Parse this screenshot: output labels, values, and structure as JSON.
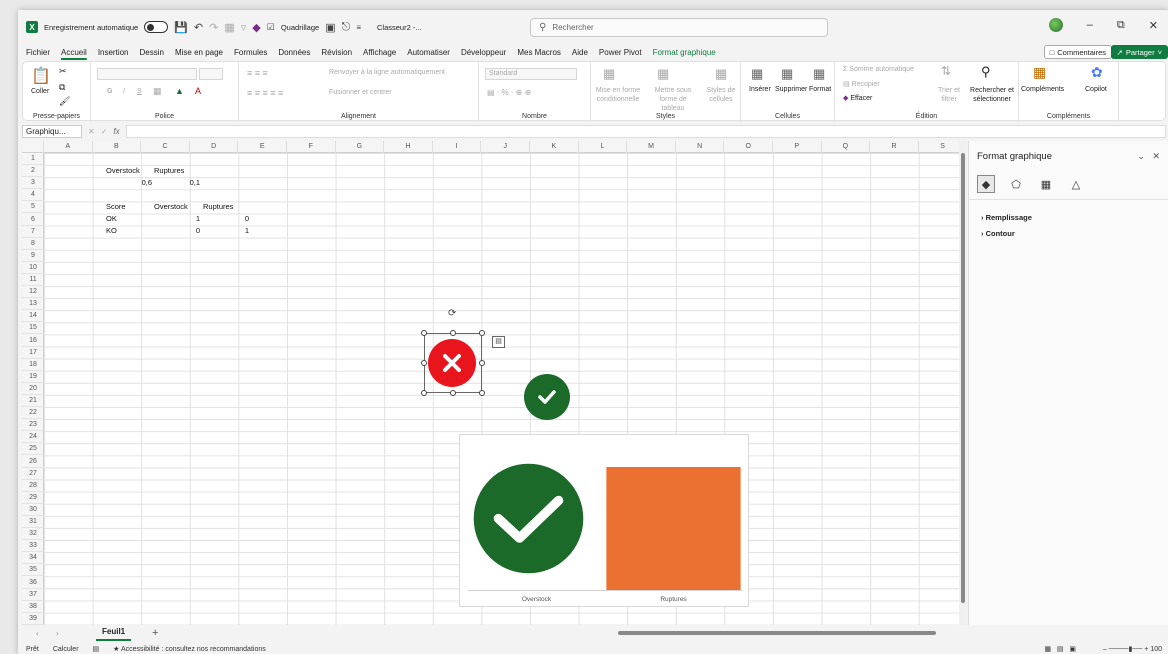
{
  "titlebar": {
    "autosave_label": "Enregistrement automatique",
    "gridlines_label": "Quadrillage",
    "file_name": "Classeur2 -...",
    "search_placeholder": "Rechercher"
  },
  "menu": {
    "items": [
      "Fichier",
      "Accueil",
      "Insertion",
      "Dessin",
      "Mise en page",
      "Formules",
      "Données",
      "Révision",
      "Affichage",
      "Automatiser",
      "Développeur",
      "Mes Macros",
      "Aide",
      "Power Pivot",
      "Format graphique"
    ],
    "active": "Accueil",
    "comments_label": "Commentaires",
    "share_label": "Partager"
  },
  "ribbon": {
    "groups": {
      "clipboard": "Presse-papiers",
      "font": "Police",
      "alignment": "Alignement",
      "number": "Nombre",
      "styles": "Styles",
      "cells": "Cellules",
      "editing": "Édition",
      "addins": "Compléments"
    },
    "paste": "Coller",
    "font_bold": "G",
    "font_italic": "I",
    "font_underline": "S",
    "wrap_text": "Renvoyer à la ligne automatiquement",
    "merge_center": "Fusionner et centrer",
    "number_format": "Standard",
    "cond_format": "Mise en forme conditionnelle",
    "format_table": "Mettre sous forme de tableau",
    "cell_styles": "Styles de cellules",
    "insert": "Insérer",
    "delete": "Supprimer",
    "format": "Format",
    "autosum": "Somme automatique",
    "fill": "Recopier",
    "clear": "Effacer",
    "sort_filter": "Trier et filtrer",
    "find_select": "Rechercher et sélectionner",
    "addins": "Compléments",
    "copilot": "Copilot"
  },
  "formula_bar": {
    "name_box": "Graphiqu...",
    "fx": "fx"
  },
  "sheet": {
    "columns": [
      "A",
      "B",
      "C",
      "D",
      "E",
      "F",
      "G",
      "H",
      "I",
      "J",
      "K",
      "L",
      "M",
      "N",
      "O",
      "P",
      "Q",
      "R",
      "S"
    ],
    "rows": [
      "1",
      "2",
      "3",
      "4",
      "5",
      "6",
      "7",
      "8",
      "9",
      "10",
      "11",
      "12",
      "13",
      "14",
      "15",
      "16",
      "17",
      "18",
      "19",
      "20",
      "21",
      "22",
      "23",
      "24",
      "25",
      "26",
      "27",
      "28",
      "29",
      "30",
      "31",
      "32",
      "33",
      "34",
      "35",
      "36",
      "37",
      "38",
      "39"
    ],
    "cells": {
      "B2": "Overstock",
      "C2": "Ruptures",
      "B3": "0,6",
      "C3": "0,1",
      "B5": "Score",
      "C5": "Overstock",
      "D5": "Ruptures",
      "B6": "OK",
      "C6": "1",
      "D6": "0",
      "B7": "KO",
      "C7": "0",
      "D7": "1"
    }
  },
  "chart_data": {
    "type": "bar",
    "categories": [
      "Overstock",
      "Ruptures"
    ],
    "values": [
      1,
      1
    ],
    "title": "",
    "xlabel": "",
    "ylabel": "",
    "colors": [
      "#1b6a2a",
      "#ea7131"
    ],
    "legend": "none",
    "grid": false
  },
  "panel": {
    "title": "Format graphique",
    "sections": [
      "Remplissage",
      "Contour"
    ]
  },
  "sheet_tabs": {
    "active": "Feuil1",
    "add": "+"
  },
  "status": {
    "ready": "Prêt",
    "calc": "Calculer",
    "accessibility": "Accessibilité : consultez nos recommandations",
    "zoom": "100"
  },
  "colors": {
    "accent": "#107c41",
    "x_red": "#e8161c",
    "check_green": "#1b6a2a",
    "orange": "#ea7131"
  }
}
